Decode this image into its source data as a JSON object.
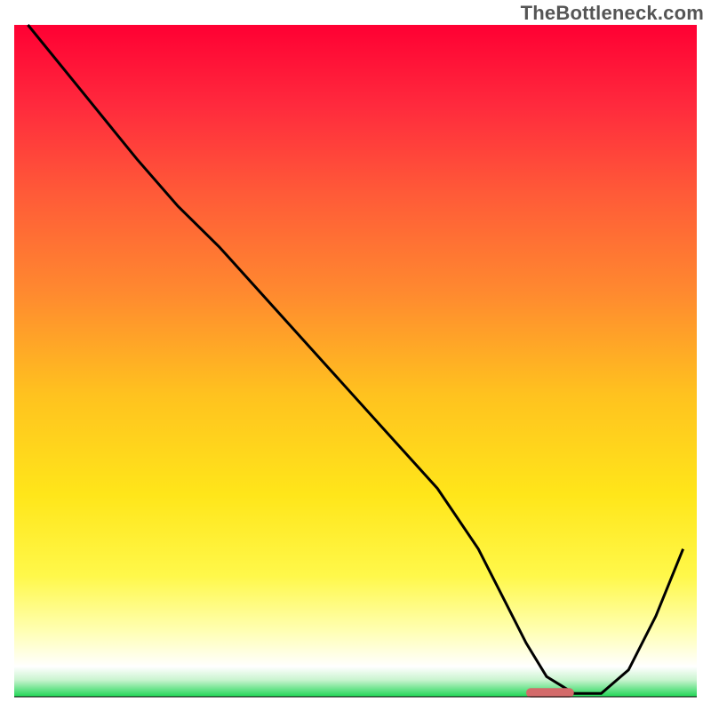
{
  "watermark": "TheBottleneck.com",
  "chart_data": {
    "type": "line",
    "title": "",
    "xlabel": "",
    "ylabel": "",
    "xlim": [
      0,
      100
    ],
    "ylim": [
      0,
      100
    ],
    "grid": false,
    "legend": false,
    "axes_visible": false,
    "background": {
      "type": "vertical_gradient",
      "stops": [
        {
          "pos": 0.0,
          "color": "#ff0033"
        },
        {
          "pos": 0.12,
          "color": "#ff2a3d"
        },
        {
          "pos": 0.25,
          "color": "#ff5a38"
        },
        {
          "pos": 0.4,
          "color": "#ff8a2f"
        },
        {
          "pos": 0.55,
          "color": "#ffc21f"
        },
        {
          "pos": 0.7,
          "color": "#ffe61a"
        },
        {
          "pos": 0.82,
          "color": "#fff84a"
        },
        {
          "pos": 0.9,
          "color": "#ffffb0"
        },
        {
          "pos": 0.955,
          "color": "#ffffff"
        },
        {
          "pos": 0.975,
          "color": "#c9f4cf"
        },
        {
          "pos": 1.0,
          "color": "#1fd655"
        }
      ]
    },
    "series": [
      {
        "name": "bottleneck_curve",
        "stroke": "#000000",
        "stroke_width": 3,
        "x": [
          2,
          10,
          18,
          24,
          30,
          38,
          46,
          54,
          62,
          68,
          72,
          75,
          78,
          82,
          86,
          90,
          94,
          98
        ],
        "y": [
          100,
          90,
          80,
          73,
          67,
          58,
          49,
          40,
          31,
          22,
          14,
          8,
          3,
          0.5,
          0.5,
          4,
          12,
          22
        ]
      }
    ],
    "marker": {
      "name": "optimum_marker",
      "x_center": 78.5,
      "y": 0.6,
      "width": 7,
      "height": 1.4,
      "color": "#d36a6a",
      "rx": 0.7
    }
  }
}
